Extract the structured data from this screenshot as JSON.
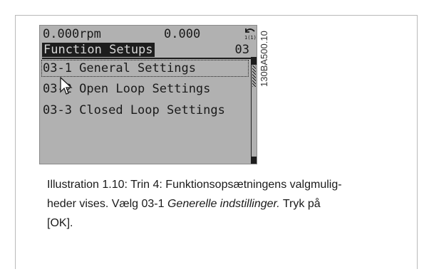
{
  "lcd": {
    "rpm": "0.000rpm",
    "value2": "0.000",
    "back_icon": "back-arrow-icon",
    "back_label": "1(1)",
    "function_title": "Function Setups",
    "function_number": "03",
    "items": [
      {
        "label": "03-1 General Settings",
        "selected": true
      },
      {
        "label": "03-2 Open Loop Settings",
        "selected": false
      },
      {
        "label": "03-3 Closed Loop Settings",
        "selected": false
      }
    ]
  },
  "figure_code": "130BA500.10",
  "caption": {
    "line1": "Illustration 1.10: Trin 4: Funktionsopsætningens valgmulig-",
    "line2_a": "heder vises. Vælg 03-1 ",
    "line2_em": "Generelle indstillinger.",
    "line2_b": " Tryk på",
    "line3": "[OK]."
  }
}
